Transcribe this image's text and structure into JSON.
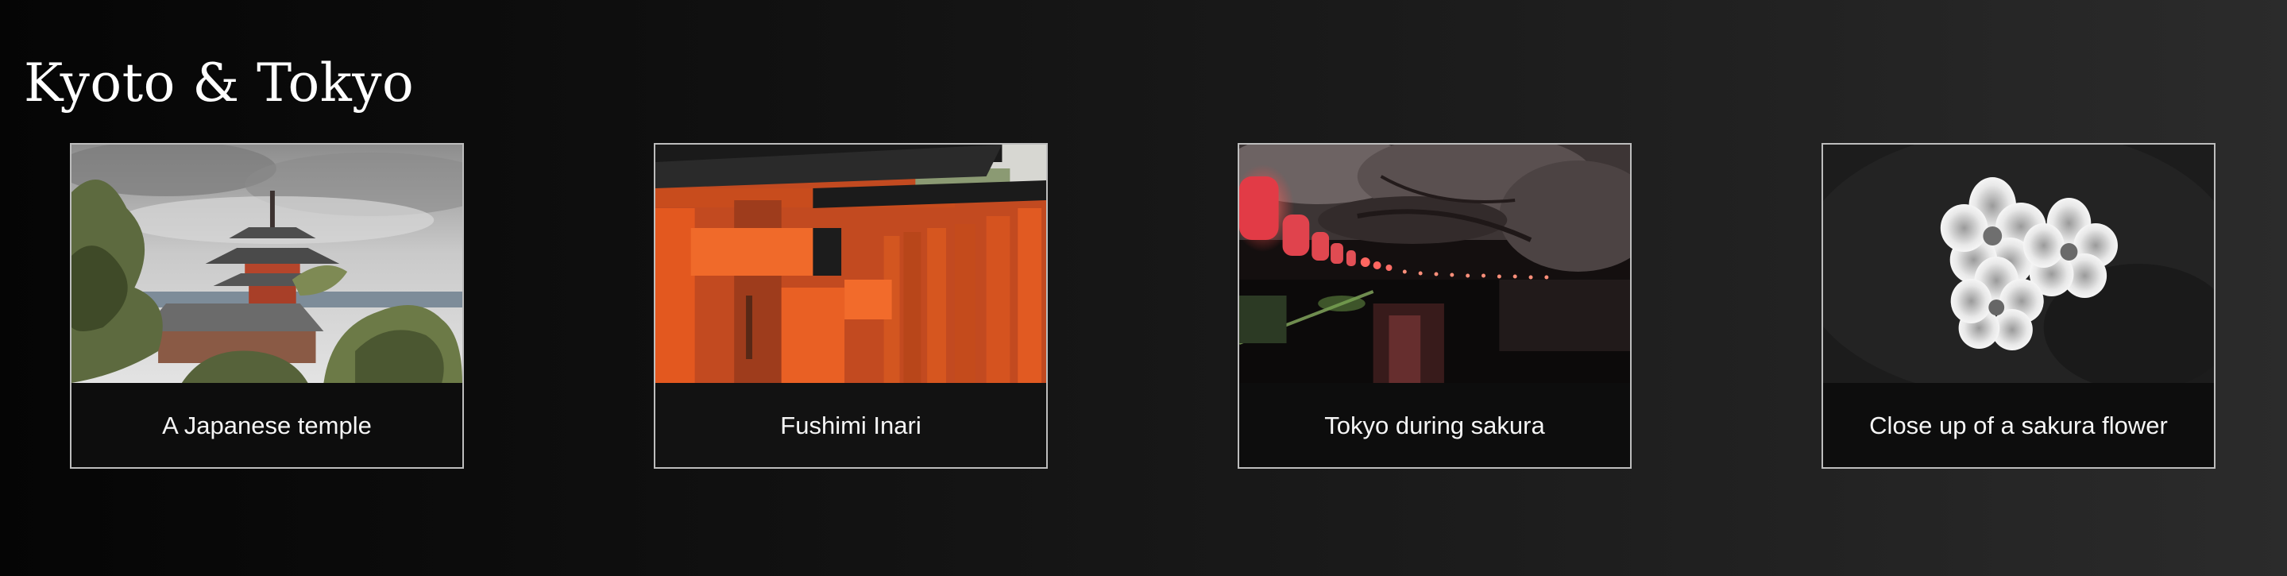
{
  "page": {
    "title": "Kyoto & Tokyo"
  },
  "gallery": {
    "cards": [
      {
        "caption": "A Japanese temple",
        "image": "pagoda-temple-photo"
      },
      {
        "caption": "Fushimi Inari",
        "image": "torii-gates-photo"
      },
      {
        "caption": "Tokyo during sakura",
        "image": "night-lanterns-river-photo"
      },
      {
        "caption": "Close up of a sakura flower",
        "image": "sakura-flower-photo"
      }
    ]
  },
  "colors": {
    "background_start": "#050505",
    "background_end": "#2b2b2b",
    "card_border": "#bdbdbd",
    "torii_orange": "#e2541e"
  }
}
